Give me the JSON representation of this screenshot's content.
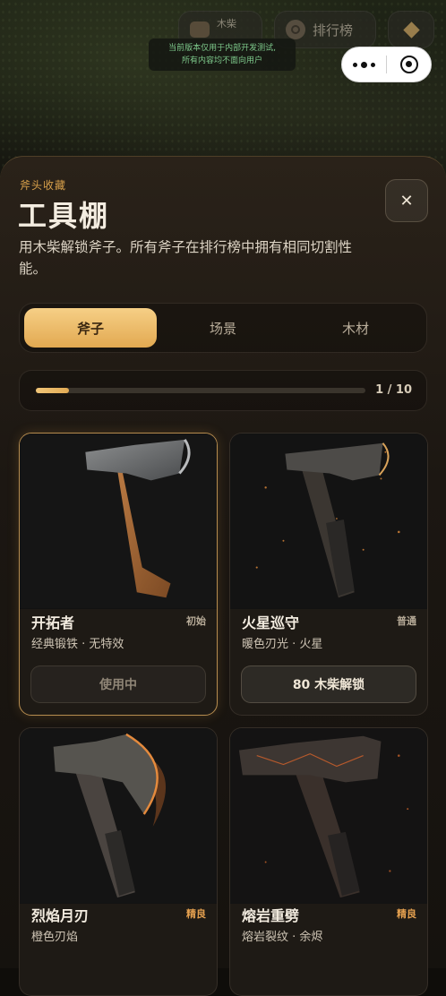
{
  "top_bar": {
    "wood_label": "木柴",
    "wood_icon": "log-icon",
    "rank_label": "排行榜",
    "rank_icon": "medal-icon",
    "diamond_icon": "diamond-icon"
  },
  "notice": {
    "line1": "当前版本仅用于内部开发测试,",
    "line2": "所有内容均不面向用户"
  },
  "capsule": {
    "more_icon": "more-dots-icon",
    "close_icon": "miniprogram-close-icon"
  },
  "header": {
    "eyebrow": "斧头收藏",
    "title": "工具棚",
    "description": "用木柴解锁斧子。所有斧子在排行榜中拥有相同切割性能。",
    "close_glyph": "✕"
  },
  "tabs": [
    {
      "label": "斧子",
      "active": true
    },
    {
      "label": "场景",
      "active": false
    },
    {
      "label": "木材",
      "active": false
    }
  ],
  "progress": {
    "text": "1 / 10",
    "unlocked": 1,
    "total": 10
  },
  "cards": [
    {
      "name": "开拓者",
      "rarity": "初始",
      "subtitle": "经典锻铁 · 无特效",
      "action": "使用中",
      "state": "in-use"
    },
    {
      "name": "火星巡守",
      "rarity": "普通",
      "subtitle": "暖色刃光 · 火星",
      "action": "80 木柴解锁",
      "state": "locked"
    },
    {
      "name": "烈焰月刃",
      "rarity": "精良",
      "subtitle": "橙色刃焰",
      "action": "",
      "state": "locked"
    },
    {
      "name": "熔岩重劈",
      "rarity": "精良",
      "subtitle": "熔岩裂纹 · 余烬",
      "action": "",
      "state": "locked"
    }
  ],
  "colors": {
    "accent": "#e3ab55",
    "rarity_fine": "#e4a04f",
    "notice_text": "#7ec98b"
  }
}
